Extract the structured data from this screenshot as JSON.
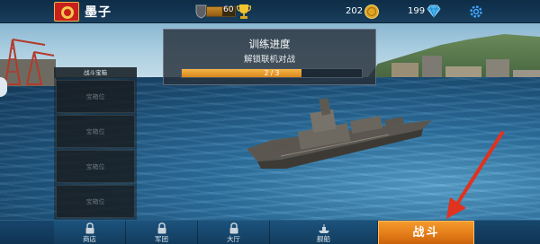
{
  "top_bar": {
    "player_name": "墨子",
    "xp_value": "60",
    "xp_fraction": 0.55,
    "gold": "202",
    "gems": "199"
  },
  "chest_panel": {
    "title": "战斗宝箱",
    "slots": [
      "宝箱位",
      "宝箱位",
      "宝箱位",
      "宝箱位"
    ]
  },
  "training": {
    "title": "训练进度",
    "subtitle": "解锁联机对战",
    "progress_text": "2 / 3",
    "progress_value": 2,
    "progress_max": 3
  },
  "bottom_nav": {
    "items": [
      {
        "label": "商店",
        "icon": "lock-icon"
      },
      {
        "label": "军团",
        "icon": "lock-icon"
      },
      {
        "label": "大厅",
        "icon": "lock-icon"
      },
      {
        "label": "舰船",
        "icon": "ship-icon"
      }
    ],
    "battle_label": "战斗"
  },
  "colors": {
    "accent_orange": "#e27a17",
    "nav_blue": "#17466c",
    "progress_orange": "#f5b548"
  }
}
